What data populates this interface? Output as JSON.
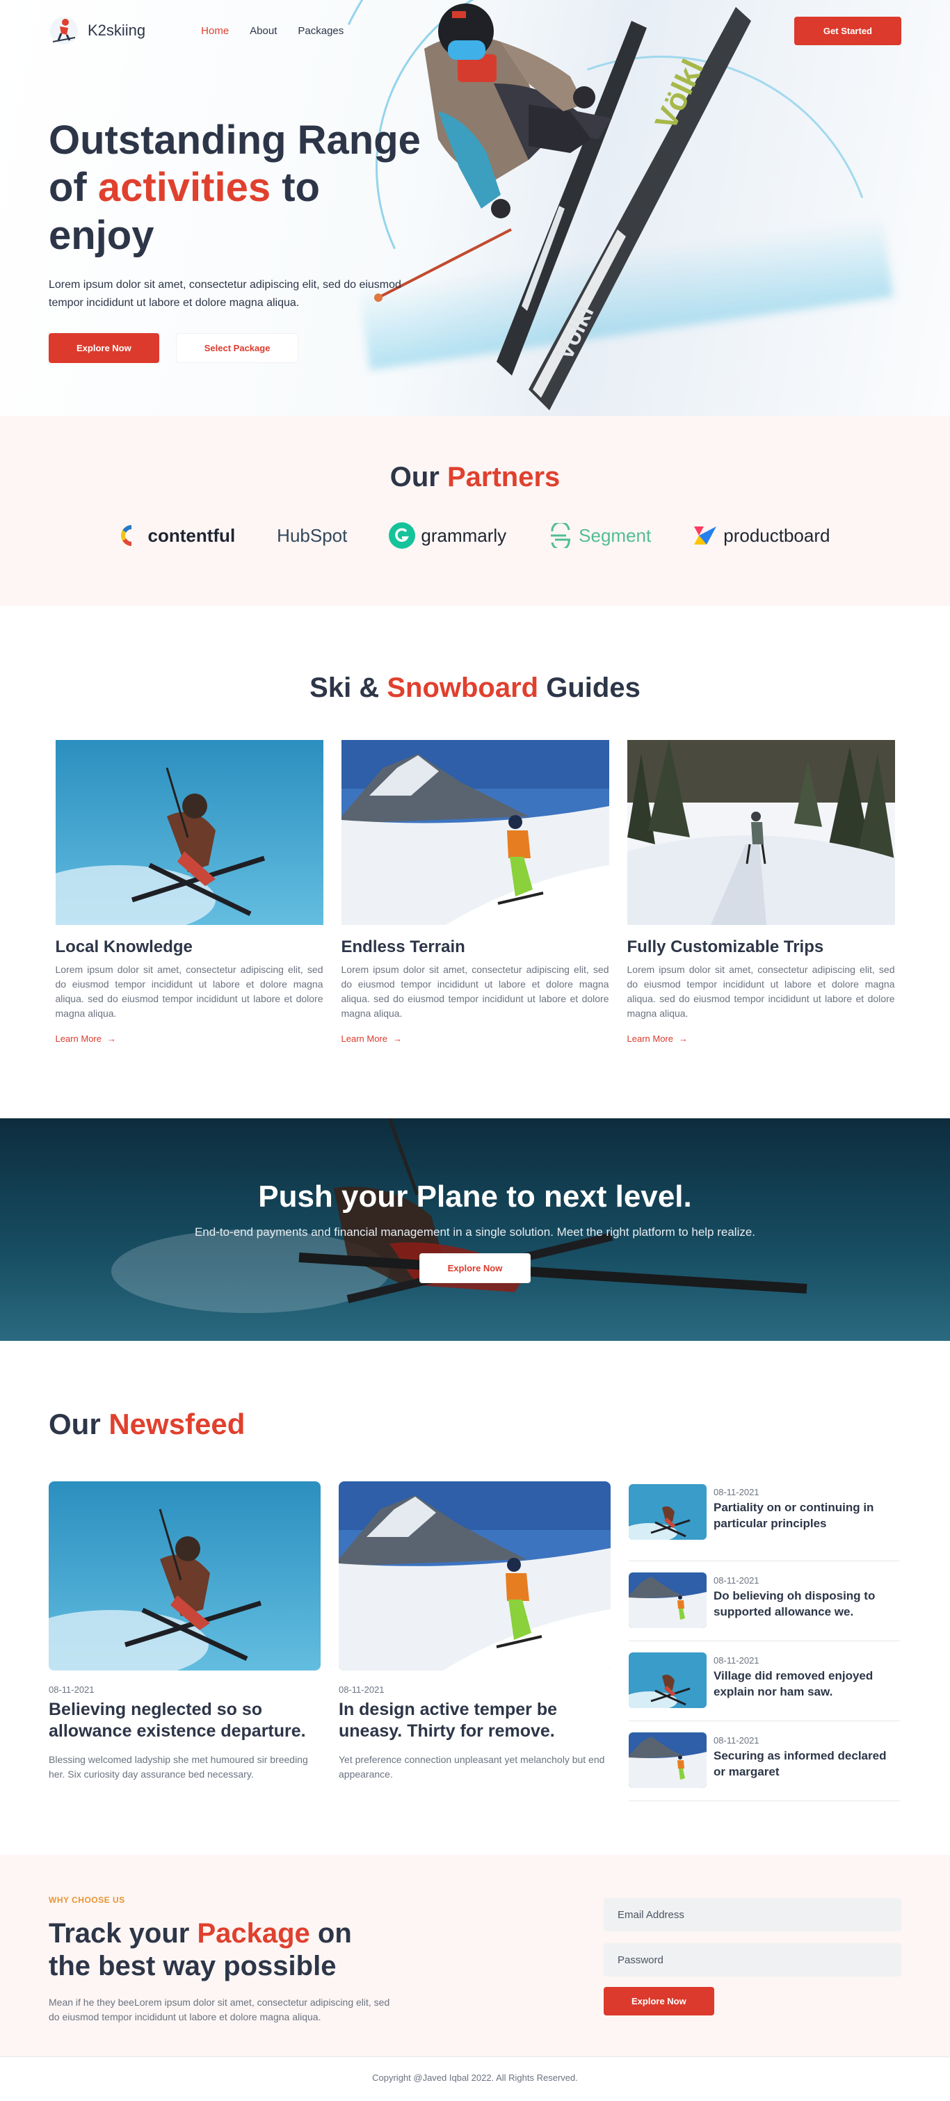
{
  "header": {
    "brand": "K2skiing",
    "nav": [
      {
        "label": "Home",
        "active": true
      },
      {
        "label": "About",
        "active": false
      },
      {
        "label": "Packages",
        "active": false
      }
    ],
    "cta_label": "Get Started"
  },
  "hero": {
    "title_line1": "Outstanding Range",
    "title_pre": "of ",
    "title_highlight": "activities",
    "title_post": " to",
    "title_line3": "enjoy",
    "description": "Lorem ipsum dolor sit amet, consectetur adipiscing elit, sed do eiusmod tempor incididunt ut labore et dolore magna aliqua.",
    "primary_label": "Explore Now",
    "secondary_label": "Select Package"
  },
  "partners": {
    "title_pre": "Our ",
    "title_highlight": "Partners",
    "items": [
      "contentful",
      "HubSpot",
      "grammarly",
      "Segment",
      "productboard"
    ]
  },
  "guides": {
    "title_pre": "Ski & ",
    "title_highlight": "Snowboard",
    "title_post": " Guides",
    "cards": [
      {
        "title": "Local Knowledge",
        "text": "Lorem ipsum dolor sit amet, consectetur adipiscing elit, sed do eiusmod tempor incididunt ut labore et dolore magna aliqua. sed do eiusmod tempor incididunt ut labore et dolore magna aliqua.",
        "link": "Learn More"
      },
      {
        "title": "Endless Terrain",
        "text": "Lorem ipsum dolor sit amet, consectetur adipiscing elit, sed do eiusmod tempor incididunt ut labore et dolore magna aliqua. sed do eiusmod tempor incididunt ut labore et dolore magna aliqua.",
        "link": "Learn More"
      },
      {
        "title": "Fully Customizable Trips",
        "text": "Lorem ipsum dolor sit amet, consectetur adipiscing elit, sed do eiusmod tempor incididunt ut labore et dolore magna aliqua. sed do eiusmod tempor incididunt ut labore et dolore magna aliqua.",
        "link": "Learn More"
      }
    ]
  },
  "cta": {
    "title": "Push your Plane to next level.",
    "text": "End-to-end payments and financial management in a single solution. Meet the right platform to help realize.",
    "button": "Explore Now"
  },
  "news": {
    "title_pre": "Our ",
    "title_highlight": "Newsfeed",
    "main": [
      {
        "date": "08-11-2021",
        "title": "Believing neglected so so allowance existence departure.",
        "text": "Blessing welcomed ladyship she met humoured sir breeding her. Six curiosity day assurance bed necessary."
      },
      {
        "date": "08-11-2021",
        "title": "In design active temper be uneasy. Thirty for remove.",
        "text": "Yet preference connection unpleasant yet melancholy but end appearance."
      }
    ],
    "side": [
      {
        "date": "08-11-2021",
        "title": "Partiality on or continuing in particular principles"
      },
      {
        "date": "08-11-2021",
        "title": "Do believing oh disposing to supported allowance we."
      },
      {
        "date": "08-11-2021",
        "title": "Village did removed enjoyed explain nor ham saw."
      },
      {
        "date": "08-11-2021",
        "title": "Securing as informed declared or margaret"
      }
    ]
  },
  "track": {
    "eyebrow": "WHY CHOOSE US",
    "title_pre": "Track your ",
    "title_highlight": "Package",
    "title_post": " on",
    "title_line2": "the best way possible",
    "text": "Mean if he they beeLorem ipsum dolor sit amet, consectetur adipiscing elit, sed do eiusmod tempor incididunt ut labore et dolore magna aliqua.",
    "email_placeholder": "Email Address",
    "password_placeholder": "Password",
    "button": "Explore Now"
  },
  "footer": {
    "copyright": "Copyright @Javed Iqbal 2022. All Rights Reserved."
  },
  "colors": {
    "accent": "#dc3a2c",
    "text": "#2d3648",
    "eyebrow": "#e89433",
    "section_bg": "#fdf6f4"
  },
  "icons": {
    "arrow": "arrow-right-icon",
    "logo": "skier-logo-icon"
  }
}
